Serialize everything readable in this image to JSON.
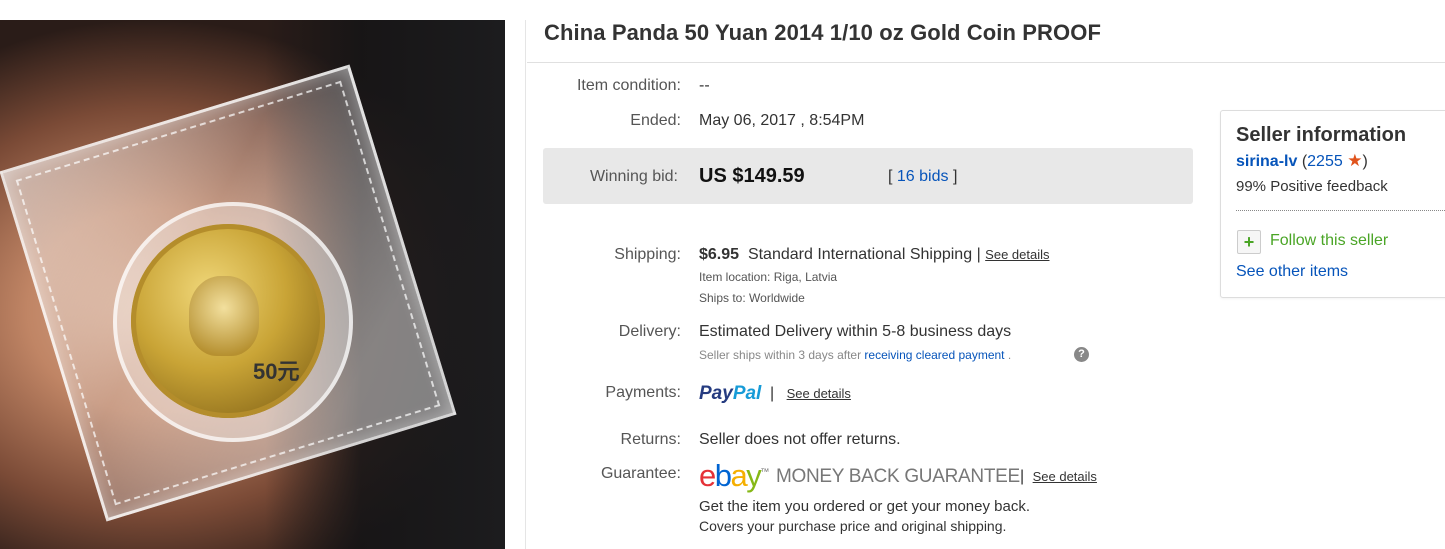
{
  "title": "China Panda 50 Yuan 2014 1/10 oz Gold Coin PROOF",
  "photo": {
    "coin_denomination": "50元"
  },
  "condition": {
    "label": "Item condition:",
    "value": "--"
  },
  "ended": {
    "label": "Ended:",
    "value": "May 06, 2017 , 8:54PM"
  },
  "winning_bid": {
    "label": "Winning bid:",
    "price": "US $149.59",
    "bids_open": "[",
    "bids_link": "16 bids",
    "bids_close": "]"
  },
  "shipping": {
    "label": "Shipping:",
    "cost": "$6.95",
    "method": "Standard International Shipping",
    "sep": "|",
    "see_details": "See details",
    "location_label": "Item location:",
    "location_value": "Riga, Latvia",
    "ships_to_label": "Ships to:",
    "ships_to_value": "Worldwide"
  },
  "delivery": {
    "label": "Delivery:",
    "estimate": "Estimated Delivery within 5-8 business days",
    "note_pre": "Seller ships within 3 days after",
    "note_link": "receiving cleared payment",
    "note_post": ".",
    "help": "?"
  },
  "payments": {
    "label": "Payments:",
    "paypal_1": "Pay",
    "paypal_2": "Pal",
    "sep": "|",
    "see_details": "See details"
  },
  "returns": {
    "label": "Returns:",
    "value": "Seller does not offer returns."
  },
  "guarantee": {
    "label": "Guarantee:",
    "ebay_e": "e",
    "ebay_b": "b",
    "ebay_a": "a",
    "ebay_y": "y",
    "tm": "™",
    "mbg": "MONEY BACK GUARANTEE",
    "sep": "|",
    "see_details": "See details",
    "line1": "Get the item you ordered or get your money back.",
    "line2": "Covers your purchase price and original shipping."
  },
  "seller": {
    "heading": "Seller information",
    "username": "sirina-lv",
    "paren_open": "(",
    "score": "2255",
    "star": "★",
    "paren_close": ")",
    "feedback": "99% Positive feedback",
    "follow_icon": "+",
    "follow": "Follow this seller",
    "see_other": "See other items"
  },
  "colors": {
    "link": "#0654ba",
    "follow_green": "#4aa526",
    "star": "#e0531c",
    "bid_box": "#e8e8e8"
  }
}
